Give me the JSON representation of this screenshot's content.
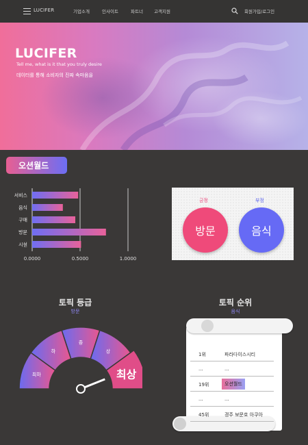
{
  "nav": {
    "logo": "LUCIFER",
    "menu": [
      "기업소개",
      "인사이트",
      "파트너",
      "고객지원"
    ],
    "login": "회원가입/로그인"
  },
  "hero": {
    "title": "LUCIFER",
    "subtitle_en": "Tell me, what is it that you truly desire",
    "subtitle_ko": "데이터를 통해 소비자의 진짜 속마음을"
  },
  "section_title": "오션월드",
  "chart_data": [
    {
      "type": "bar",
      "orientation": "horizontal",
      "categories": [
        "서비스",
        "음식",
        "구매",
        "방문",
        "시설"
      ],
      "values": [
        0.48,
        0.32,
        0.45,
        0.77,
        0.51
      ],
      "xlim": [
        0,
        1
      ],
      "xticks": [
        "0.0000",
        "0.5000",
        "1.0000"
      ],
      "colors": {
        "start": "#6f6ef2",
        "end": "#e8629a"
      }
    },
    {
      "type": "gauge",
      "segments": [
        "최하",
        "하",
        "중",
        "상",
        "최상"
      ],
      "current": "최상"
    }
  ],
  "sentiment": {
    "positive_label": "긍정",
    "positive_value": "방문",
    "negative_label": "부정",
    "negative_value": "음식",
    "colors": {
      "positive": "#ef4a7a",
      "negative": "#666af5"
    }
  },
  "topic_grade": {
    "title": "토픽 등급",
    "subtitle": "방문",
    "level_text": "최상"
  },
  "topic_rank": {
    "title": "토픽 순위",
    "subtitle": "음식",
    "rows": [
      {
        "rank": "1위",
        "name": "파라다이스시티",
        "highlight": false
      },
      {
        "rank": "...",
        "name": "...",
        "highlight": false
      },
      {
        "rank": "19위",
        "name": "오션월드",
        "highlight": true
      },
      {
        "rank": "...",
        "name": "...",
        "highlight": false
      },
      {
        "rank": "45위",
        "name": "경주 보문호 아쿠아",
        "highlight": false
      }
    ]
  }
}
